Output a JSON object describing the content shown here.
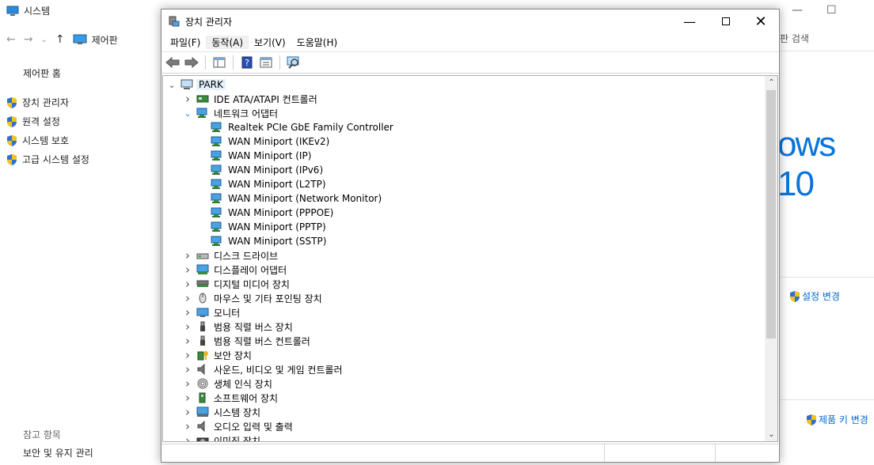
{
  "background": {
    "window_title": "시스템",
    "breadcrumb": "제어판",
    "sidebar_home": "제어판 홈",
    "sidebar_links": [
      "장치 관리자",
      "원격 설정",
      "시스템 보호",
      "고급 시스템 설정"
    ],
    "related_heading": "참고 항목",
    "related_link": "보안 및 유지 관리",
    "search_placeholder": "판 검색",
    "logo_text": "ows 10",
    "change_settings": "설정 변경",
    "change_product_key": "제품 키 변경"
  },
  "device_manager": {
    "title": "장치 관리자",
    "menu": [
      "파일(F)",
      "동작(A)",
      "보기(V)",
      "도움말(H)"
    ],
    "root": "PARK",
    "tree": [
      {
        "label": "IDE ATA/ATAPI 컨트롤러",
        "level": 1,
        "expanded": false,
        "icon": "ide-controller-icon"
      },
      {
        "label": "네트워크 어댑터",
        "level": 1,
        "expanded": true,
        "icon": "network-adapter-icon"
      },
      {
        "label": "Realtek PCIe GbE Family Controller",
        "level": 2,
        "icon": "network-adapter-icon"
      },
      {
        "label": "WAN Miniport (IKEv2)",
        "level": 2,
        "icon": "network-adapter-icon"
      },
      {
        "label": "WAN Miniport (IP)",
        "level": 2,
        "icon": "network-adapter-icon"
      },
      {
        "label": "WAN Miniport (IPv6)",
        "level": 2,
        "icon": "network-adapter-icon"
      },
      {
        "label": "WAN Miniport (L2TP)",
        "level": 2,
        "icon": "network-adapter-icon"
      },
      {
        "label": "WAN Miniport (Network Monitor)",
        "level": 2,
        "icon": "network-adapter-icon"
      },
      {
        "label": "WAN Miniport (PPPOE)",
        "level": 2,
        "icon": "network-adapter-icon"
      },
      {
        "label": "WAN Miniport (PPTP)",
        "level": 2,
        "icon": "network-adapter-icon"
      },
      {
        "label": "WAN Miniport (SSTP)",
        "level": 2,
        "icon": "network-adapter-icon"
      },
      {
        "label": "디스크 드라이브",
        "level": 1,
        "expanded": false,
        "icon": "disk-drive-icon"
      },
      {
        "label": "디스플레이 어댑터",
        "level": 1,
        "expanded": false,
        "icon": "display-adapter-icon"
      },
      {
        "label": "디지털 미디어 장치",
        "level": 1,
        "expanded": false,
        "icon": "media-device-icon"
      },
      {
        "label": "마우스 및 기타 포인팅 장치",
        "level": 1,
        "expanded": false,
        "icon": "mouse-icon"
      },
      {
        "label": "모니터",
        "level": 1,
        "expanded": false,
        "icon": "monitor-icon"
      },
      {
        "label": "범용 직렬 버스 장치",
        "level": 1,
        "expanded": false,
        "icon": "usb-device-icon"
      },
      {
        "label": "범용 직렬 버스 컨트롤러",
        "level": 1,
        "expanded": false,
        "icon": "usb-controller-icon"
      },
      {
        "label": "보안 장치",
        "level": 1,
        "expanded": false,
        "icon": "security-device-icon"
      },
      {
        "label": "사운드, 비디오 및 게임 컨트롤러",
        "level": 1,
        "expanded": false,
        "icon": "sound-icon"
      },
      {
        "label": "생체 인식 장치",
        "level": 1,
        "expanded": false,
        "icon": "biometric-icon"
      },
      {
        "label": "소프트웨어 장치",
        "level": 1,
        "expanded": false,
        "icon": "software-device-icon"
      },
      {
        "label": "시스템 장치",
        "level": 1,
        "expanded": false,
        "icon": "system-device-icon"
      },
      {
        "label": "오디오 입력 및 출력",
        "level": 1,
        "expanded": false,
        "icon": "audio-io-icon"
      },
      {
        "label": "이미징 장치",
        "level": 1,
        "expanded": false,
        "icon": "imaging-device-icon"
      }
    ]
  }
}
